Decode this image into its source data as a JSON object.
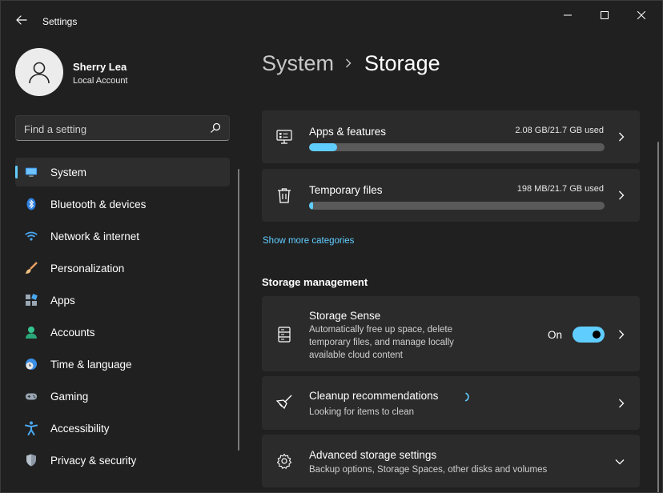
{
  "window": {
    "title": "Settings",
    "controls": [
      "minimize",
      "maximize",
      "close"
    ]
  },
  "profile": {
    "name": "Sherry Lea",
    "account_type": "Local Account"
  },
  "search": {
    "placeholder": "Find a setting"
  },
  "sidebar": {
    "items": [
      {
        "label": "System",
        "icon": "system-display-icon",
        "selected": true
      },
      {
        "label": "Bluetooth & devices",
        "icon": "bluetooth-icon"
      },
      {
        "label": "Network & internet",
        "icon": "wifi-icon"
      },
      {
        "label": "Personalization",
        "icon": "brush-icon"
      },
      {
        "label": "Apps",
        "icon": "apps-icon"
      },
      {
        "label": "Accounts",
        "icon": "person-icon"
      },
      {
        "label": "Time & language",
        "icon": "globe-clock-icon"
      },
      {
        "label": "Gaming",
        "icon": "gamepad-icon"
      },
      {
        "label": "Accessibility",
        "icon": "accessibility-icon"
      },
      {
        "label": "Privacy & security",
        "icon": "shield-icon"
      }
    ]
  },
  "breadcrumb": {
    "parent": "System",
    "current": "Storage"
  },
  "storage": {
    "categories": [
      {
        "label": "Apps & features",
        "usage": "2.08 GB/21.7 GB used",
        "fraction": 0.096,
        "icon": "apps-features-icon"
      },
      {
        "label": "Temporary files",
        "usage": "198 MB/21.7 GB used",
        "fraction": 0.009,
        "icon": "trash-icon"
      }
    ],
    "show_more_link": "Show more categories"
  },
  "management": {
    "section_title": "Storage management",
    "storage_sense": {
      "title": "Storage Sense",
      "description_lines": [
        "Automatically free up space, delete",
        "temporary files, and manage locally",
        "available cloud content"
      ],
      "toggle_label": "On",
      "toggle_on": true
    },
    "cleanup": {
      "title": "Cleanup recommendations",
      "subtitle": "Looking for items to clean"
    },
    "advanced": {
      "title": "Advanced storage settings",
      "subtitle": "Backup options, Storage Spaces, other disks and volumes"
    }
  },
  "colors": {
    "accent": "#60cdff",
    "background": "#202020",
    "card": "#2b2b2b"
  }
}
